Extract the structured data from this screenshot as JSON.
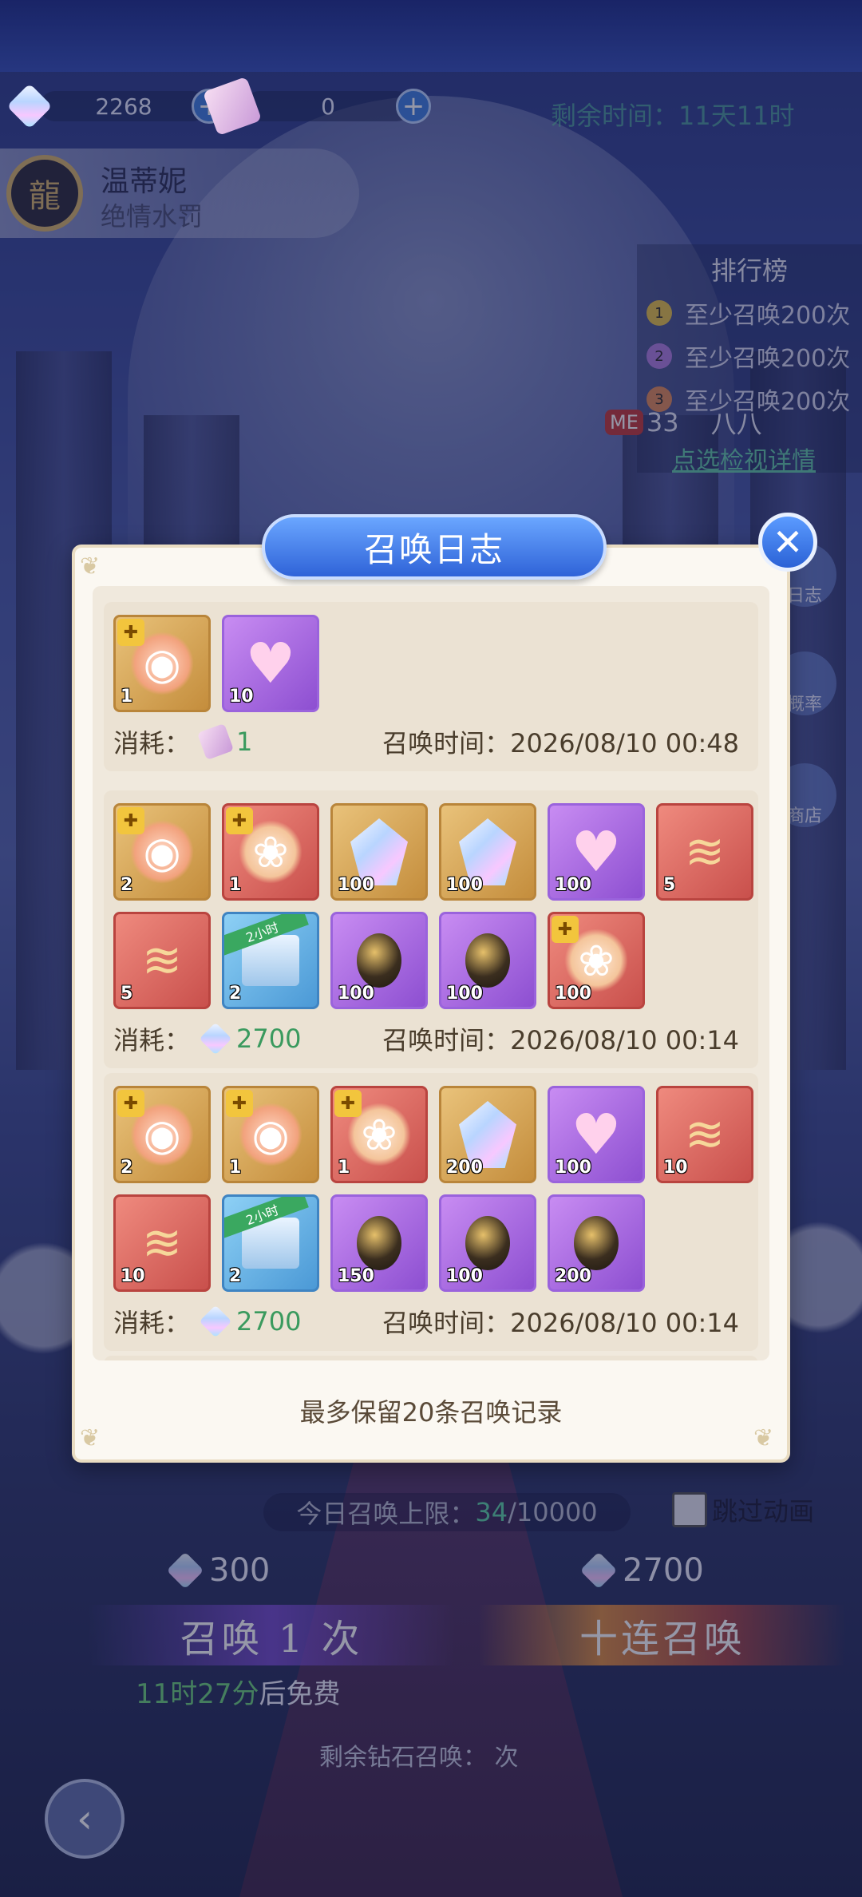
{
  "top": {
    "gems": "2268",
    "tickets": "0",
    "remain_time": "剩余时间：11天11时"
  },
  "hero": {
    "name": "温蒂妮",
    "subtitle": "绝情水罚"
  },
  "ranking": {
    "title": "排行榜",
    "rows": [
      {
        "rank": "1",
        "text": "至少召唤200次"
      },
      {
        "rank": "2",
        "text": "至少召唤200次"
      },
      {
        "rank": "3",
        "text": "至少召唤200次"
      }
    ],
    "me_badge": "ME",
    "me_rank": "33",
    "me_name": "八八",
    "link": "点选检视详情"
  },
  "side_buttons": {
    "log": "日志",
    "rate": "概率",
    "shop": "商店"
  },
  "dialog": {
    "title": "召唤日志",
    "footer": "最多保留20条召唤记录",
    "consume_label": "消耗：",
    "time_label": "召唤时间：",
    "records": [
      {
        "items": [
          {
            "type": "gold",
            "art": "shard",
            "puzzle": true,
            "qty": "1"
          },
          {
            "type": "purple",
            "art": "heart",
            "qty": "10"
          }
        ],
        "cost_icon": "ticket-icon",
        "cost": "1",
        "time": "2026/08/10 00:48"
      },
      {
        "items": [
          {
            "type": "gold",
            "art": "shard",
            "puzzle": true,
            "qty": "2"
          },
          {
            "type": "red",
            "art": "girl",
            "puzzle": true,
            "qty": "1"
          },
          {
            "type": "gold",
            "art": "crystal",
            "qty": "100"
          },
          {
            "type": "gold",
            "art": "crystal",
            "qty": "100"
          },
          {
            "type": "purple",
            "art": "heart",
            "qty": "100"
          },
          {
            "type": "red",
            "art": "dragon",
            "qty": "5"
          },
          {
            "type": "red",
            "art": "dragon",
            "qty": "5"
          },
          {
            "type": "blue",
            "art": "chest",
            "tag": "2小时",
            "qty": "2"
          },
          {
            "type": "purple",
            "art": "egg",
            "qty": "100"
          },
          {
            "type": "purple",
            "art": "egg",
            "qty": "100"
          },
          {
            "type": "red",
            "art": "girl",
            "puzzle": true,
            "qty": "100"
          }
        ],
        "cost_icon": "gem-icon",
        "cost": "2700",
        "time": "2026/08/10 00:14"
      },
      {
        "items": [
          {
            "type": "gold",
            "art": "shard",
            "puzzle": true,
            "qty": "2"
          },
          {
            "type": "gold",
            "art": "shard",
            "puzzle": true,
            "qty": "1"
          },
          {
            "type": "red",
            "art": "girl",
            "puzzle": true,
            "qty": "1"
          },
          {
            "type": "gold",
            "art": "crystal",
            "qty": "200"
          },
          {
            "type": "purple",
            "art": "heart",
            "qty": "100"
          },
          {
            "type": "red",
            "art": "dragon",
            "qty": "10"
          },
          {
            "type": "red",
            "art": "dragon",
            "qty": "10"
          },
          {
            "type": "blue",
            "art": "chest",
            "tag": "2小时",
            "qty": "2"
          },
          {
            "type": "purple",
            "art": "egg",
            "qty": "150"
          },
          {
            "type": "purple",
            "art": "egg",
            "qty": "100"
          },
          {
            "type": "purple",
            "art": "egg",
            "qty": "200"
          }
        ],
        "cost_icon": "gem-icon",
        "cost": "2700",
        "time": "2026/08/10 00:14"
      }
    ]
  },
  "summon": {
    "limit_prefix": "今日召唤上限：",
    "limit_used": "34",
    "limit_total": "/10000",
    "skip_label": "跳过动画",
    "cost_one": "300",
    "cost_ten": "2700",
    "one_label": "召唤 1 次",
    "ten_label": "十连召唤",
    "free_time": "11时27分",
    "free_suffix": "后免费",
    "remain_diamond": "剩余钻石召唤：  次"
  }
}
